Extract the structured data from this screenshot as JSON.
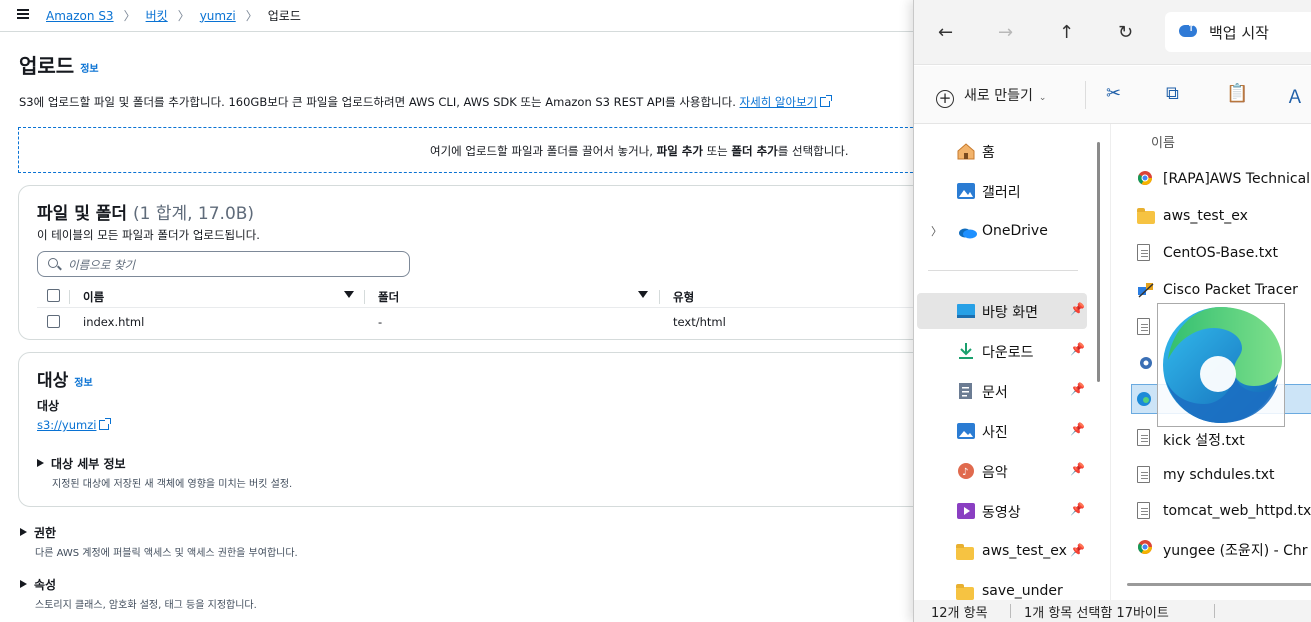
{
  "s3": {
    "breadcrumb": [
      "Amazon S3",
      "버킷",
      "yumzi",
      "업로드"
    ],
    "page_title": "업로드",
    "info_label": "정보",
    "description": "S3에 업로드할 파일 및 폴더를 추가합니다. 160GB보다 큰 파일을 업로드하려면 AWS CLI, AWS SDK 또는 Amazon S3 REST API를 사용합니다.",
    "learn_more": "자세히 알아보기",
    "dropzone": {
      "pre": "여기에 업로드할 파일과 폴더를 끌어서 놓거나, ",
      "add_files": "파일 추가",
      "mid": " 또는 ",
      "add_folder": "폴더 추가",
      "post": "를 선택합니다."
    },
    "files_panel": {
      "title": "파일 및 폴더",
      "count": "(1 합계, 17.0B)",
      "subtitle": "이 테이블의 모든 파일과 폴더가 업로드됩니다.",
      "search_placeholder": "이름으로 찾기",
      "columns": [
        "이름",
        "폴더",
        "유형"
      ],
      "rows": [
        {
          "name": "index.html",
          "folder": "-",
          "type": "text/html"
        }
      ]
    },
    "dest_panel": {
      "title": "대상",
      "info_label": "정보",
      "label": "대상",
      "link": "s3://yumzi",
      "details_title": "대상 세부 정보",
      "details_sub": "지정된 대상에 저장된 새 객체에 영향을 미치는 버킷 설정."
    },
    "permissions": {
      "title": "권한",
      "sub": "다른 AWS 계정에 퍼블릭 액세스 및 액세스 권한을 부여합니다."
    },
    "properties": {
      "title": "속성",
      "sub": "스토리지 클래스, 암호화 설정, 태그 등을 지정합니다."
    }
  },
  "explorer": {
    "backup_label": "백업 시작",
    "new_label": "새로 만들기",
    "column_name": "이름",
    "nav": [
      {
        "label": "홈",
        "icon": "home-icon"
      },
      {
        "label": "갤러리",
        "icon": "gallery-icon"
      },
      {
        "label": "OneDrive",
        "icon": "onedrive-icon"
      },
      {
        "label": "바탕 화면",
        "icon": "desktop-icon"
      },
      {
        "label": "다운로드",
        "icon": "download-icon"
      },
      {
        "label": "문서",
        "icon": "documents-icon"
      },
      {
        "label": "사진",
        "icon": "pictures-icon"
      },
      {
        "label": "음악",
        "icon": "music-icon"
      },
      {
        "label": "동영상",
        "icon": "videos-icon"
      },
      {
        "label": "aws_test_ex",
        "icon": "folder-icon"
      },
      {
        "label": "save_under",
        "icon": "folder-icon"
      }
    ],
    "files": [
      {
        "label": "[RAPA]AWS Technical",
        "icon": "chrome-icon"
      },
      {
        "label": "aws_test_ex",
        "icon": "folder-shortcut-icon"
      },
      {
        "label": "CentOS-Base.txt",
        "icon": "text-file-icon"
      },
      {
        "label": "Cisco Packet Tracer",
        "icon": "cisco-icon"
      },
      {
        "label": "",
        "icon": "text-file-icon"
      },
      {
        "label": "",
        "icon": "app-shortcut-icon"
      },
      {
        "label": "",
        "icon": "edge-icon"
      },
      {
        "label": "kick 설정.txt",
        "icon": "text-file-icon"
      },
      {
        "label": "my schdules.txt",
        "icon": "text-file-icon"
      },
      {
        "label": "tomcat_web_httpd.txt",
        "icon": "text-file-icon"
      },
      {
        "label": "yungee (조윤지) - Chr",
        "icon": "chrome-icon"
      }
    ],
    "status": {
      "count": "12개 항목",
      "selected": "1개 항목 선택함 17바이트"
    }
  }
}
